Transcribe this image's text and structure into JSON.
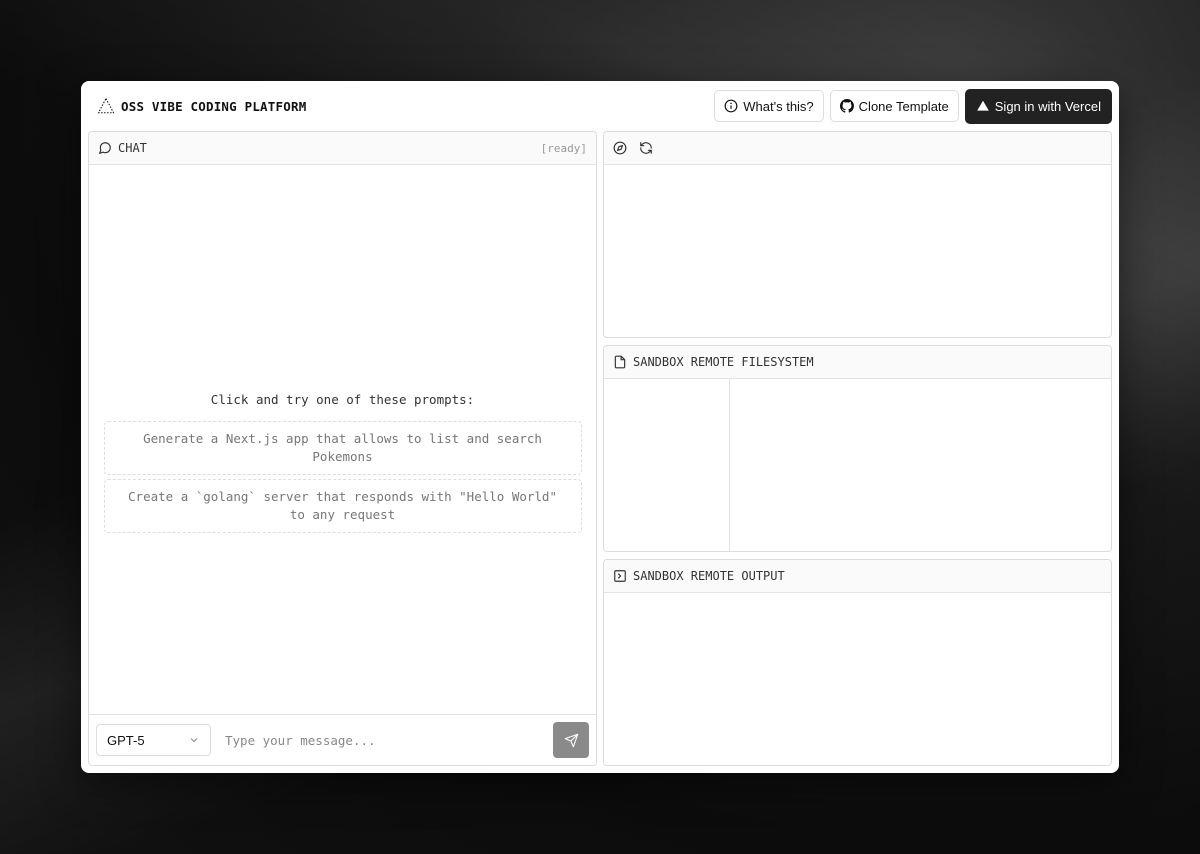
{
  "app": {
    "title": "OSS VIBE CODING PLATFORM"
  },
  "header": {
    "whats_this_label": "What's this?",
    "clone_template_label": "Clone Template",
    "sign_in_label": "Sign in with Vercel"
  },
  "chat": {
    "title": "CHAT",
    "status": "[ready]",
    "prompts_title": "Click and try one of these prompts:",
    "prompts": [
      "Generate a Next.js app that allows to list and search Pokemons",
      "Create a `golang` server that responds with \"Hello World\" to any request"
    ],
    "model_selected": "GPT-5",
    "input_placeholder": "Type your message..."
  },
  "panels": {
    "filesystem_title": "SANDBOX REMOTE FILESYSTEM",
    "output_title": "SANDBOX REMOTE OUTPUT"
  },
  "icons": {
    "logo": "triangle-dotted-icon",
    "info": "info-icon",
    "github": "github-icon",
    "vercel": "vercel-triangle-icon",
    "chat": "message-circle-icon",
    "compass": "compass-icon",
    "refresh": "refresh-icon",
    "file": "file-icon",
    "terminal": "terminal-icon",
    "chevron": "chevron-down-icon",
    "send": "send-icon"
  },
  "colors": {
    "accent_dark": "#222222",
    "send_button": "#8a8a8a"
  }
}
